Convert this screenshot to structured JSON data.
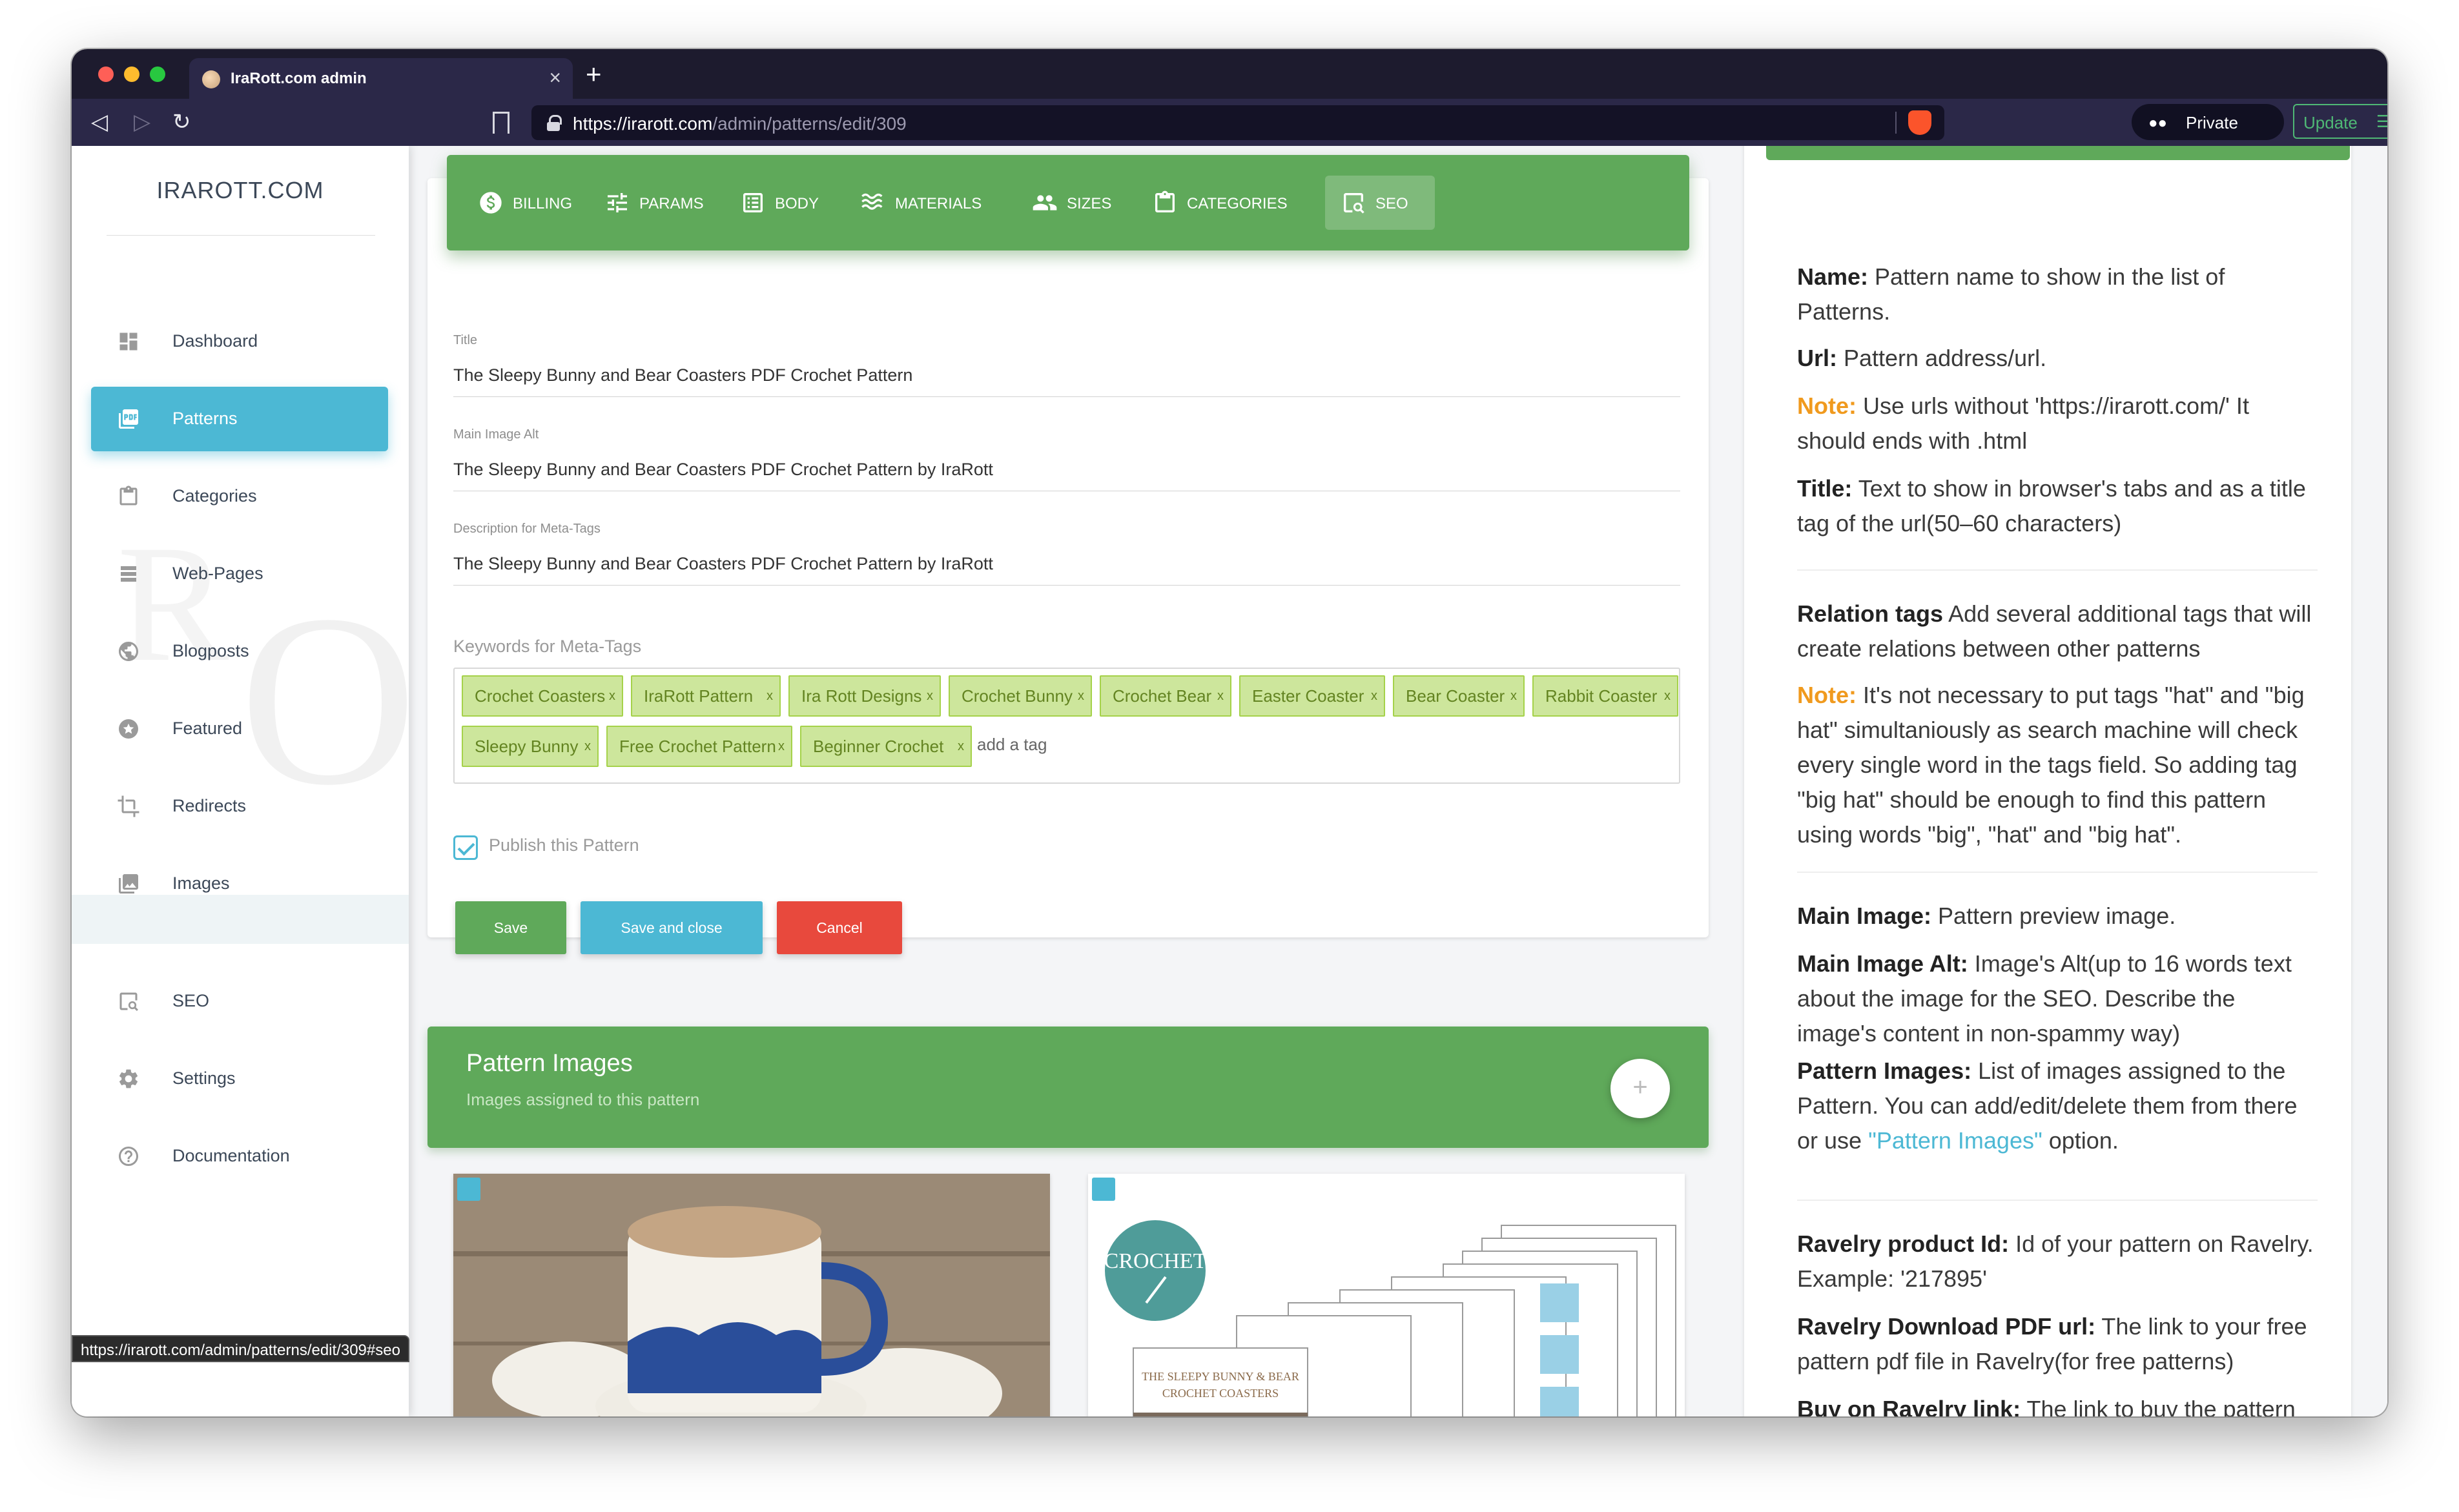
{
  "browser": {
    "tab_title": "IraRott.com admin",
    "url_host": "https://irarott.com",
    "url_path": "/admin/patterns/edit/309",
    "private_label": "Private",
    "update_label": "Update",
    "status_url": "https://irarott.com/admin/patterns/edit/309#seo"
  },
  "sidebar": {
    "logo": "IRAROTT.COM",
    "items": [
      {
        "label": "Dashboard",
        "icon": "dashboard-icon"
      },
      {
        "label": "Patterns",
        "icon": "pdf-icon",
        "active": true
      },
      {
        "label": "Categories",
        "icon": "clipboard-icon"
      },
      {
        "label": "Web-Pages",
        "icon": "web-pages-icon"
      },
      {
        "label": "Blogposts",
        "icon": "globe-icon"
      },
      {
        "label": "Featured",
        "icon": "star-icon"
      },
      {
        "label": "Redirects",
        "icon": "crop-icon"
      },
      {
        "label": "Images",
        "icon": "image-icon"
      },
      {
        "label": "SEO",
        "icon": "seo-icon"
      },
      {
        "label": "Settings",
        "icon": "gear-icon"
      },
      {
        "label": "Documentation",
        "icon": "help-icon"
      }
    ]
  },
  "tabs": [
    {
      "label": "BILLING",
      "icon": "dollar-icon"
    },
    {
      "label": "PARAMS",
      "icon": "sliders-icon"
    },
    {
      "label": "BODY",
      "icon": "list-icon"
    },
    {
      "label": "MATERIALS",
      "icon": "waves-icon"
    },
    {
      "label": "SIZES",
      "icon": "people-icon"
    },
    {
      "label": "CATEGORIES",
      "icon": "clipboard-icon"
    },
    {
      "label": "SEO",
      "icon": "seo-icon",
      "active": true
    }
  ],
  "form": {
    "title_label": "Title",
    "title_value": "The Sleepy Bunny and Bear Coasters PDF Crochet Pattern",
    "alt_label": "Main Image Alt",
    "alt_value": "The Sleepy Bunny and Bear Coasters PDF Crochet Pattern by IraRott",
    "desc_label": "Description for Meta-Tags",
    "desc_value": "The Sleepy Bunny and Bear Coasters PDF Crochet Pattern by IraRott",
    "keywords_label": "Keywords for Meta-Tags",
    "tags": [
      "Crochet Coasters",
      "IraRott Pattern",
      "Ira Rott Designs",
      "Crochet Bunny",
      "Crochet Bear",
      "Easter Coaster",
      "Bear Coaster",
      "Rabbit Coaster",
      "Sleepy Bunny",
      "Free Crochet Pattern",
      "Beginner Crochet"
    ],
    "tag_remove": "x",
    "tag_placeholder": "add a tag",
    "publish_label": "Publish this Pattern",
    "publish_checked": true,
    "save": "Save",
    "save_close": "Save and close",
    "cancel": "Cancel"
  },
  "pattern_images": {
    "title": "Pattern Images",
    "subtitle": "Images assigned to this pattern",
    "add": "+",
    "crochet_badge": "CROCHET",
    "doc_title": "THE SLEEPY BUNNY & BEAR",
    "doc_subtitle": "CROCHET COASTERS"
  },
  "help": {
    "name_b": "Name:",
    "name_t": " Pattern name to show in the list of Patterns.",
    "url_b": "Url:",
    "url_t": " Pattern address/url.",
    "note1_b": "Note:",
    "note1_t": " Use urls without 'https://irarott.com/' It should ends with .html",
    "title_b": "Title:",
    "title_t": " Text to show in browser's tabs and as a title tag of the url(50–60 characters)",
    "rel_b": "Relation tags",
    "rel_t": " Add several additional tags that will create relations between other patterns",
    "note2_b": "Note:",
    "note2_t": " It's not necessary to put tags \"hat\" and \"big hat\" simultaniously as search machine will check every single word in the tags field. So adding tag \"big hat\" should be enough to find this pattern using words \"big\", \"hat\" and \"big hat\".",
    "mi_b": "Main Image:",
    "mi_t": " Pattern preview image.",
    "mia_b": "Main Image Alt:",
    "mia_t": " Image's Alt(up to 16 words text about the image for the SEO. Describe the image's content in non-spammy way)",
    "pi_b": "Pattern Images:",
    "pi_t1": " List of images assigned to the Pattern. You can add/edit/delete them from there or use ",
    "pi_link": "\"Pattern Images\"",
    "pi_t2": " option.",
    "rav_b": "Ravelry product Id:",
    "rav_t": " Id of your pattern on Ravelry. Example: '217895'",
    "ravdl_b": "Ravelry Download PDF url:",
    "ravdl_t": " The link to your free pattern pdf file in Ravelry(for free patterns)",
    "buy_b": "Buy on Ravelry link:",
    "buy_t": " The link to buy the pattern directly on Ravelry(Will be hidden if empty)"
  },
  "colors": {
    "accent_green": "#5fa95a",
    "accent_cyan": "#4cb8d4",
    "danger_red": "#e8493d",
    "note_orange": "#f09a1e",
    "tag_bg": "#cde69c"
  }
}
